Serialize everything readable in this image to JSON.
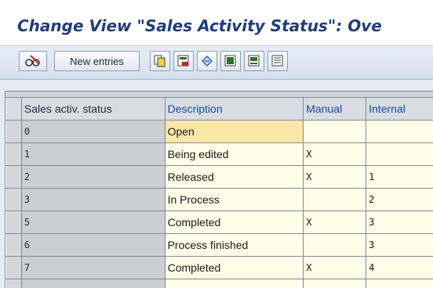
{
  "title": "Change View \"Sales Activity Status\": Ove",
  "toolbar": {
    "items": [
      {
        "name": "edit-toggle-button",
        "icon": "glasses-pencil-icon"
      },
      {
        "name": "new-entries-button",
        "label": "New entries"
      },
      {
        "name": "copy-as-button",
        "icon": "copy-icon"
      },
      {
        "name": "delete-button",
        "icon": "delete-icon"
      },
      {
        "name": "undo-change-button",
        "icon": "undo-icon"
      },
      {
        "name": "select-all-button",
        "icon": "select-all-icon"
      },
      {
        "name": "select-block-button",
        "icon": "select-block-icon"
      },
      {
        "name": "deselect-all-button",
        "icon": "deselect-all-icon"
      }
    ]
  },
  "table": {
    "columns": [
      "Sales activ. status",
      "Description",
      "Manual",
      "Internal"
    ],
    "rows": [
      {
        "status": "0",
        "description": "Open",
        "manual": "",
        "internal": ""
      },
      {
        "status": "1",
        "description": "Being edited",
        "manual": "X",
        "internal": ""
      },
      {
        "status": "2",
        "description": "Released",
        "manual": "X",
        "internal": "1"
      },
      {
        "status": "3",
        "description": "In Process",
        "manual": "",
        "internal": "2"
      },
      {
        "status": "5",
        "description": "Completed",
        "manual": "X",
        "internal": "3"
      },
      {
        "status": "6",
        "description": "Process finished",
        "manual": "",
        "internal": "3"
      },
      {
        "status": "7",
        "description": "Completed",
        "manual": "X",
        "internal": "4"
      }
    ]
  }
}
